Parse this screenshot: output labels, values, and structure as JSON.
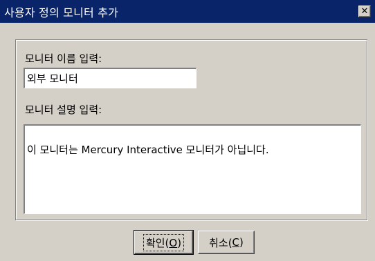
{
  "window": {
    "title": "사용자 정의 모니터 추가",
    "close_symbol": "✕"
  },
  "form": {
    "name_label": "모니터 이름 입력:",
    "name_value": "외부 모니터",
    "description_label": "모니터 설명 입력:",
    "description_value": "이 모니터는 Mercury Interactive 모니터가 아닙니다."
  },
  "buttons": {
    "ok_label": "확인(",
    "ok_mnemonic": "O",
    "ok_suffix": ")",
    "cancel_label": "취소(",
    "cancel_mnemonic": "C",
    "cancel_suffix": ")"
  }
}
